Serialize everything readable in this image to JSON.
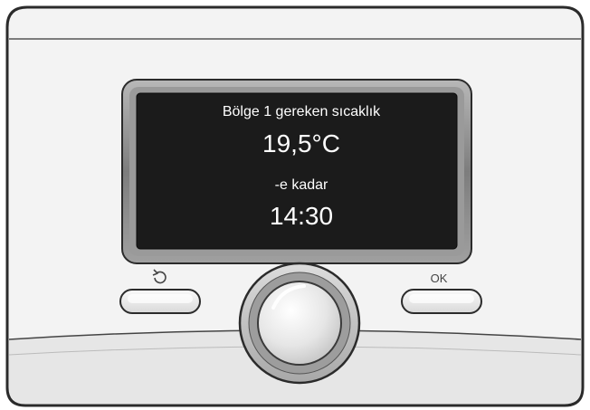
{
  "display": {
    "title": "Bölge 1 gereken sıcaklık",
    "temperature": "19,5°C",
    "until_label": "-e kadar",
    "time": "14:30"
  },
  "buttons": {
    "back_icon": "back-arrow-icon",
    "ok_label": "OK"
  },
  "colors": {
    "body": "#f2f2f2",
    "outline": "#333333",
    "screen": "#1a1a1a",
    "bezel": "#8c8c8c",
    "lower_panel": "#e4e4e4"
  }
}
